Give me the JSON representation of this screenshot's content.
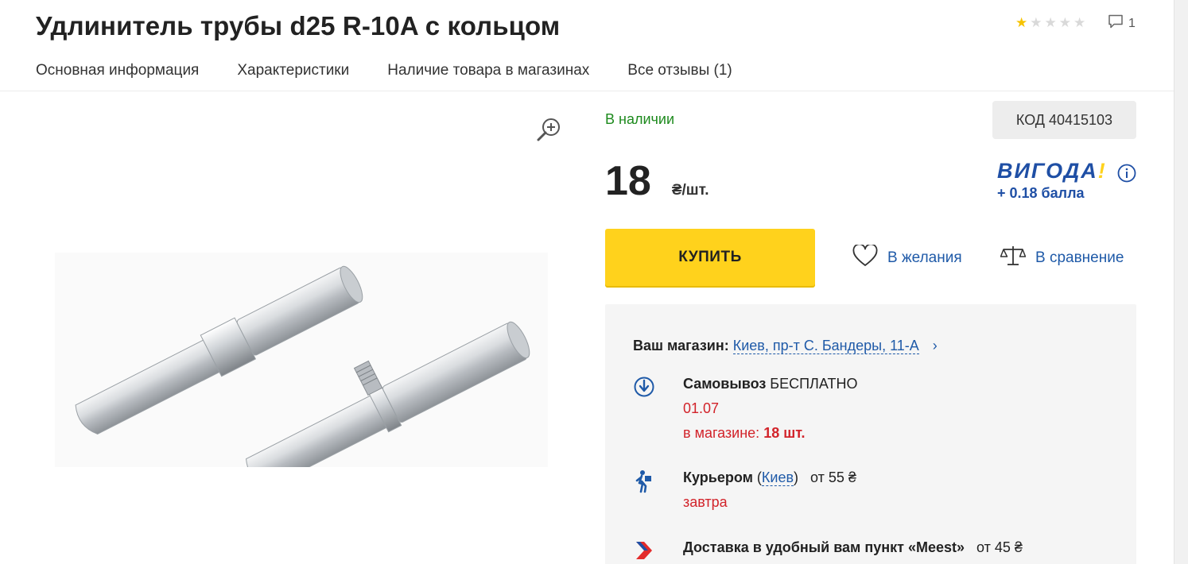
{
  "product": {
    "title": "Удлинитель трубы d25 R-10A с кольцом",
    "rating_stars": 1,
    "rating_max": 5,
    "reviews_count": "1"
  },
  "tabs": [
    {
      "label": "Основная информация"
    },
    {
      "label": "Характеристики"
    },
    {
      "label": "Наличие товара в магазинах"
    },
    {
      "label": "Все отзывы (1)"
    }
  ],
  "purchase": {
    "stock_status": "В наличии",
    "code": "КОД 40415103",
    "price": "18",
    "price_unit": "₴/шт.",
    "buy_label": "КУПИТЬ",
    "wishlist_label": "В желания",
    "compare_label": "В сравнение"
  },
  "loyalty": {
    "logo_text": "ВИГОДА",
    "logo_mark": "!",
    "bonus": "+ 0.18 балла"
  },
  "delivery": {
    "store_label": "Ваш магазин:",
    "store_name": "Киев, пр-т С. Бандеры, 11-А",
    "store_chevron": "›",
    "pickup": {
      "title": "Самовывоз",
      "price": "БЕСПЛАТНО",
      "date": "01.07",
      "in_store_label": "в магазине:",
      "in_store_qty": "18 шт."
    },
    "courier": {
      "title": "Курьером",
      "city": "Киев",
      "price": "от 55 ₴",
      "when": "завтра"
    },
    "meest": {
      "title": "Доставка в удобный вам пункт «Meest»",
      "price": "от 45 ₴"
    }
  },
  "colors": {
    "accent_yellow": "#ffd21c",
    "link_blue": "#1f5aa8",
    "stock_green": "#1d8a1d",
    "red": "#d2232a"
  },
  "icons": [
    "comment-icon",
    "star-icon",
    "zoom-in-icon",
    "heart-icon",
    "scales-icon",
    "info-icon",
    "pickup-icon",
    "courier-icon",
    "meest-icon"
  ]
}
